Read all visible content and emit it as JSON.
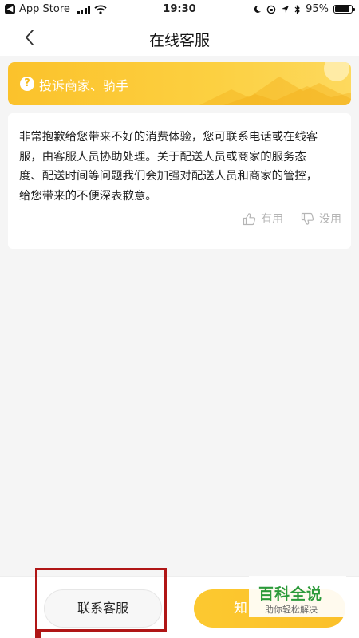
{
  "status_bar": {
    "app_back_label": "App Store",
    "time": "19:30",
    "battery_text": "95%"
  },
  "nav": {
    "title": "在线客服"
  },
  "banner": {
    "text": "投诉商家、骑手",
    "icon": "question-icon"
  },
  "card": {
    "lines": [
      "非常抱歉给您带来不好的消费体验，您可联系电话或在线客",
      "服，由客服人员协助处理。关于配送人员或商家的服务态",
      "度、配送时间等问题我们会加强对配送人员和商家的管控，",
      "给您带来的不便深表歉意。"
    ],
    "useful_label": "有用",
    "useless_label": "没用"
  },
  "bottom": {
    "contact_label": "联系客服",
    "confirm_label": "知"
  },
  "watermark": {
    "main": "百科全说",
    "sub": "助你轻松解决"
  },
  "colors": {
    "accent": "#fbc22b",
    "highlight": "#b01616",
    "watermark_green": "#2b9a3a"
  }
}
